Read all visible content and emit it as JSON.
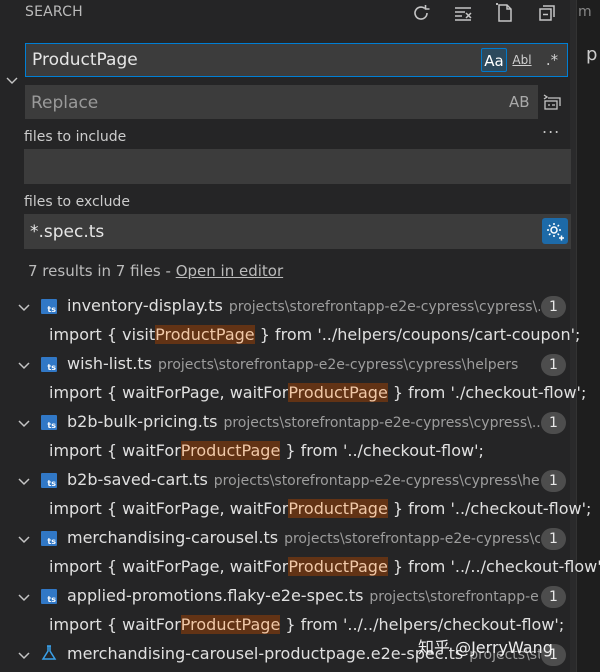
{
  "header": {
    "title": "SEARCH",
    "icons": [
      "refresh-icon",
      "clear-results-icon",
      "new-search-editor-icon",
      "collapse-all-icon"
    ]
  },
  "gutter": {
    "tab_char": "m",
    "char": "p"
  },
  "search": {
    "value": "ProductPage",
    "option_case": "Aa",
    "option_word": "Abl",
    "option_regex": ".*"
  },
  "replace": {
    "placeholder": "Replace",
    "preserve_case": "AB",
    "more": "..."
  },
  "include": {
    "label": "files to include",
    "value": ""
  },
  "exclude": {
    "label": "files to exclude",
    "value": "*.spec.ts"
  },
  "summary": {
    "text": "7 results in 7 files - ",
    "open_in_editor": "Open in editor"
  },
  "results": [
    {
      "icon": "ts",
      "name": "inventory-display.ts",
      "path": "projects\\storefrontapp-e2e-cypress\\cypress\\...",
      "count": "1",
      "match": {
        "before": "import { visit",
        "hit": "ProductPage",
        "after": " } from '../helpers/coupons/cart-coupon';"
      }
    },
    {
      "icon": "ts",
      "name": "wish-list.ts",
      "path": "projects\\storefrontapp-e2e-cypress\\cypress\\helpers",
      "count": "1",
      "match": {
        "before": "import { waitForPage, waitFor",
        "hit": "ProductPage",
        "after": " } from './checkout-flow';"
      }
    },
    {
      "icon": "ts",
      "name": "b2b-bulk-pricing.ts",
      "path": "projects\\storefrontapp-e2e-cypress\\cypress\\...",
      "count": "1",
      "match": {
        "before": "import { waitFor",
        "hit": "ProductPage",
        "after": " } from '../checkout-flow';"
      }
    },
    {
      "icon": "ts",
      "name": "b2b-saved-cart.ts",
      "path": "projects\\storefrontapp-e2e-cypress\\cypress\\he...",
      "count": "1",
      "match": {
        "before": "import { waitForPage, waitFor",
        "hit": "ProductPage",
        "after": " } from '../checkout-flow';"
      }
    },
    {
      "icon": "ts",
      "name": "merchandising-carousel.ts",
      "path": "projects\\storefrontapp-e2e-cypress\\c...",
      "count": "1",
      "match": {
        "before": "import { waitForPage, waitFor",
        "hit": "ProductPage",
        "after": " } from '../../checkout-flow';"
      }
    },
    {
      "icon": "ts",
      "name": "applied-promotions.flaky-e2e-spec.ts",
      "path": "projects\\storefrontapp-e...",
      "count": "1",
      "match": {
        "before": "import { waitFor",
        "hit": "ProductPage",
        "after": " } from '../../helpers/checkout-flow';"
      }
    },
    {
      "icon": "flask",
      "name": "merchandising-carousel-productpage.e2e-spec.ts",
      "path": "projects\\st...",
      "count": "1",
      "match": null
    }
  ],
  "watermark": "知乎 @JerryWang",
  "colors": {
    "background": "#252526",
    "input_bg": "#3c3c3c",
    "focus_border": "#007fd4",
    "match_highlight": "#623315",
    "ts_icon": "#3178c6"
  }
}
